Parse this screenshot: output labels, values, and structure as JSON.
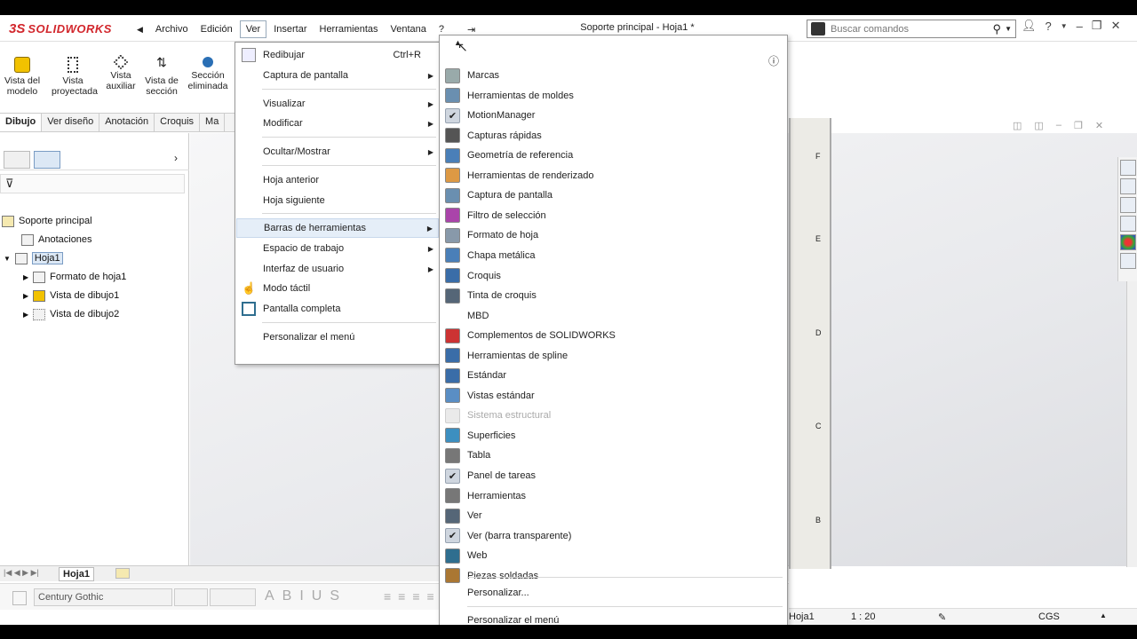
{
  "app": {
    "logo_ds": "3S",
    "logo_text": "SOLIDWORKS",
    "doc_title": "Soporte principal - Hoja1 *"
  },
  "menubar": [
    "Archivo",
    "Edición",
    "Ver",
    "Insertar",
    "Herramientas",
    "Ventana",
    "?"
  ],
  "search": {
    "placeholder": "Buscar comandos"
  },
  "ribbon": [
    {
      "l1": "Vista del",
      "l2": "modelo"
    },
    {
      "l1": "Vista",
      "l2": "proyectada"
    },
    {
      "l1": "Vista",
      "l2": "auxiliar"
    },
    {
      "l1": "Vista de",
      "l2": "sección"
    },
    {
      "l1": "Sección",
      "l2": "eliminada"
    }
  ],
  "tabs": [
    "Dibujo",
    "Ver diseño",
    "Anotación",
    "Croquis",
    "Ma"
  ],
  "tree": {
    "root": "Soporte principal",
    "annotations": "Anotaciones",
    "sheet": "Hoja1",
    "children": [
      "Formato de hoja1",
      "Vista de dibujo1",
      "Vista de dibujo2"
    ]
  },
  "bottom": {
    "sheet_tab": "Hoja1"
  },
  "fontbar": {
    "font": "Century Gothic"
  },
  "statusbar": {
    "sheet": "Hoja1",
    "scale": "1 : 20",
    "units": "CGS"
  },
  "sheet_letters": [
    "F",
    "E",
    "D",
    "C",
    "B"
  ],
  "ver_menu": {
    "redibujar": "Redibujar",
    "redibujar_shortcut": "Ctrl+R",
    "captura": "Captura de pantalla",
    "visualizar": "Visualizar",
    "modificar": "Modificar",
    "ocultar": "Ocultar/Mostrar",
    "hoja_anterior": "Hoja anterior",
    "hoja_siguiente": "Hoja siguiente",
    "barras": "Barras de herramientas",
    "espacio": "Espacio de trabajo",
    "interfaz": "Interfaz de usuario",
    "tactil": "Modo táctil",
    "completa": "Pantalla completa",
    "personalizar": "Personalizar el menú"
  },
  "toolbars_menu": {
    "items": [
      {
        "label": "Marcas",
        "checked": false,
        "disabled": false,
        "icon": "marks-icon"
      },
      {
        "label": "Herramientas de moldes",
        "checked": false,
        "disabled": false,
        "icon": "mold-icon"
      },
      {
        "label": "MotionManager",
        "checked": true,
        "disabled": false,
        "icon": "check-icon"
      },
      {
        "label": "Capturas rápidas",
        "checked": false,
        "disabled": false,
        "icon": "snapshot-icon"
      },
      {
        "label": "Geometría de referencia",
        "checked": false,
        "disabled": false,
        "icon": "reference-geometry-icon"
      },
      {
        "label": "Herramientas de renderizado",
        "checked": false,
        "disabled": false,
        "icon": "render-icon"
      },
      {
        "label": "Captura de pantalla",
        "checked": false,
        "disabled": false,
        "icon": "screen-capture-icon"
      },
      {
        "label": "Filtro de selección",
        "checked": false,
        "disabled": false,
        "icon": "filter-icon"
      },
      {
        "label": "Formato de hoja",
        "checked": false,
        "disabled": false,
        "icon": "sheet-format-icon"
      },
      {
        "label": "Chapa metálica",
        "checked": false,
        "disabled": false,
        "icon": "sheet-metal-icon"
      },
      {
        "label": "Croquis",
        "checked": false,
        "disabled": false,
        "icon": "sketch-icon"
      },
      {
        "label": "Tinta de croquis",
        "checked": false,
        "disabled": false,
        "icon": "sketch-ink-icon"
      },
      {
        "label": "MBD",
        "checked": false,
        "disabled": false,
        "icon": ""
      },
      {
        "label": "Complementos de SOLIDWORKS",
        "checked": false,
        "disabled": false,
        "icon": "addins-icon"
      },
      {
        "label": "Herramientas de spline",
        "checked": false,
        "disabled": false,
        "icon": "spline-icon"
      },
      {
        "label": "Estándar",
        "checked": false,
        "disabled": false,
        "icon": "standard-icon"
      },
      {
        "label": "Vistas estándar",
        "checked": false,
        "disabled": false,
        "icon": "standard-views-icon"
      },
      {
        "label": "Sistema estructural",
        "checked": false,
        "disabled": true,
        "icon": "structure-icon"
      },
      {
        "label": "Superficies",
        "checked": false,
        "disabled": false,
        "icon": "surfaces-icon"
      },
      {
        "label": "Tabla",
        "checked": false,
        "disabled": false,
        "icon": "table-icon"
      },
      {
        "label": "Panel de tareas",
        "checked": true,
        "disabled": false,
        "icon": "check-icon"
      },
      {
        "label": "Herramientas",
        "checked": false,
        "disabled": false,
        "icon": "tools-icon"
      },
      {
        "label": "Ver",
        "checked": false,
        "disabled": false,
        "icon": "view-icon"
      },
      {
        "label": "Ver (barra transparente)",
        "checked": true,
        "disabled": false,
        "icon": "check-icon"
      },
      {
        "label": "Web",
        "checked": false,
        "disabled": false,
        "icon": "web-icon"
      },
      {
        "label": "Piezas soldadas",
        "checked": false,
        "disabled": false,
        "icon": "weldments-icon"
      }
    ],
    "personalizar": "Personalizar...",
    "personalizar_menu": "Personalizar el menú"
  }
}
